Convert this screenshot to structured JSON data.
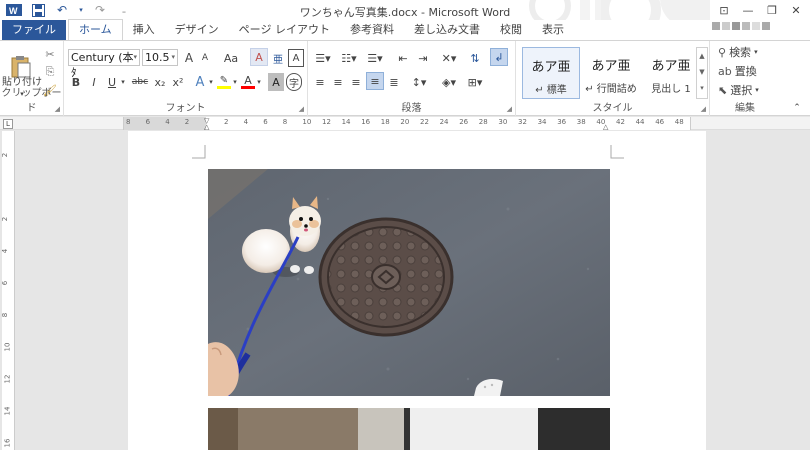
{
  "title": "ワンちゃん写真集.docx - Microsoft Word",
  "quick_access": {
    "icons": [
      "word-logo-icon",
      "save-icon",
      "undo-icon",
      "redo-icon",
      "customize-qat-icon"
    ]
  },
  "window": {
    "help": "?",
    "ribbon_display": "⊡",
    "minimize": "—",
    "restore": "❐",
    "close": "✕"
  },
  "tabs": [
    "ファイル",
    "ホーム",
    "挿入",
    "デザイン",
    "ページ レイアウト",
    "参考資料",
    "差し込み文書",
    "校閲",
    "表示"
  ],
  "active_tab": "ホーム",
  "clipboard": {
    "paste_label": "貼り付け",
    "group_label": "クリップボード"
  },
  "font": {
    "name": "Century (本ﾀ",
    "size": "10.5",
    "group_label": "フォント",
    "bold": "B",
    "italic": "I",
    "underline": "U",
    "strike": "abc",
    "subscript": "x₂",
    "superscript": "x²",
    "case": "Aa",
    "grow": "A",
    "shrink": "A"
  },
  "paragraph": {
    "group_label": "段落"
  },
  "styles": {
    "group_label": "スタイル",
    "items": [
      {
        "sample": "あア亜",
        "name": "↵ 標準"
      },
      {
        "sample": "あア亜",
        "name": "↵ 行間詰め"
      },
      {
        "sample": "あア亜",
        "name": "見出し 1"
      }
    ]
  },
  "editing": {
    "group_label": "編集",
    "find": "検索",
    "replace": "置換",
    "select": "選択"
  },
  "ruler": {
    "ticks": [
      "8",
      "6",
      "4",
      "2",
      "",
      "2",
      "4",
      "6",
      "8",
      "10",
      "12",
      "14",
      "16",
      "18",
      "20",
      "22",
      "24",
      "26",
      "28",
      "30",
      "32",
      "34",
      "36",
      "38",
      "40",
      "42",
      "44",
      "46",
      "48"
    ],
    "tab_selector": "L"
  },
  "vruler": {
    "ticks": [
      "2",
      "",
      "2",
      "4",
      "6",
      "8",
      "10",
      "12",
      "14",
      "16"
    ]
  },
  "colors": {
    "accent": "#2b579a",
    "highlight": "#ffff00",
    "font_color": "#ff0000"
  }
}
